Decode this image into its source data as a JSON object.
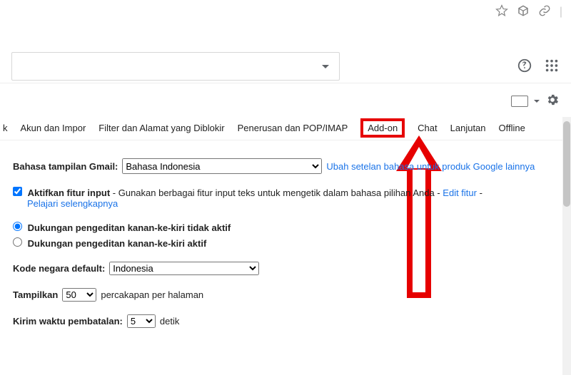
{
  "tabs": {
    "partial": "k",
    "akun": "Akun dan Impor",
    "filter": "Filter dan Alamat yang Diblokir",
    "pop": "Penerusan dan POP/IMAP",
    "addon": "Add-on",
    "chat": "Chat",
    "lanjutan": "Lanjutan",
    "offline": "Offline"
  },
  "lang": {
    "label": "Bahasa tampilan Gmail:",
    "value": "Bahasa Indonesia",
    "changeLink": "Ubah setelan bahasa untuk produk Google lainnya"
  },
  "input": {
    "enableLabel": "Aktifkan fitur input",
    "desc": " - Gunakan berbagai fitur input teks untuk mengetik dalam bahasa pilihan Anda - ",
    "editLink": "Edit fitur",
    "dash": " - ",
    "learnLink": "Pelajari selengkapnya"
  },
  "rtl": {
    "off": "Dukungan pengeditan kanan-ke-kiri tidak aktif",
    "on": "Dukungan pengeditan kanan-ke-kiri aktif"
  },
  "country": {
    "label": "Kode negara default:",
    "value": "Indonesia"
  },
  "pagesize": {
    "label": "Tampilkan",
    "value": "50",
    "suffix": "percakapan per halaman"
  },
  "undo": {
    "label": "Kirim waktu pembatalan:",
    "value": "5",
    "suffix": "detik"
  }
}
